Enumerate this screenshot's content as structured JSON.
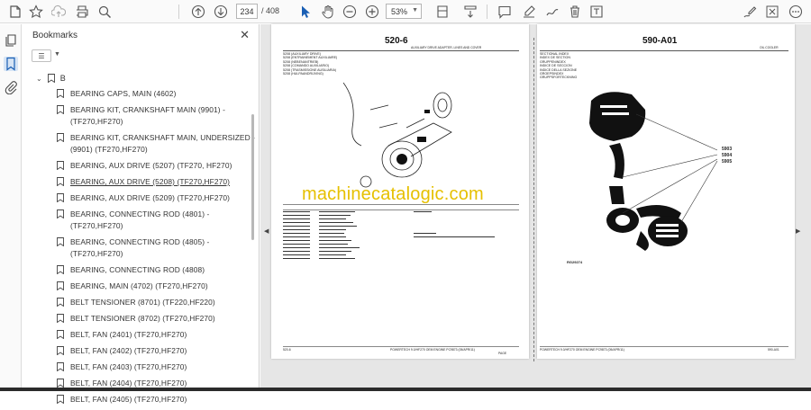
{
  "toolbar": {
    "page_current": "234",
    "page_total": "/ 408",
    "zoom": "53%"
  },
  "bookmarks": {
    "title": "Bookmarks",
    "root_label": "B",
    "items": [
      {
        "label": "BEARING CAPS, MAIN (4602)"
      },
      {
        "label": "BEARING KIT, CRANKSHAFT MAIN (9901) - (TF270,HF270)"
      },
      {
        "label": "BEARING KIT, CRANKSHAFT MAIN, UNDERSIZED - (9901) (TF270,HF270)"
      },
      {
        "label": "BEARING, AUX DRIVE (5207) (TF270, HF270)"
      },
      {
        "label": "BEARING, AUX DRIVE (5208) (TF270,HF270)"
      },
      {
        "label": "BEARING, AUX DRIVE (5209) (TF270,HF270)"
      },
      {
        "label": "BEARING, CONNECTING ROD (4801) - (TF270,HF270)"
      },
      {
        "label": "BEARING, CONNECTING ROD (4805) - (TF270,HF270)"
      },
      {
        "label": "BEARING, CONNECTING ROD (4808)"
      },
      {
        "label": "BEARING, MAIN (4702) (TF270,HF270)"
      },
      {
        "label": "BELT TENSIONER (8701) (TF220,HF220)"
      },
      {
        "label": "BELT TENSIONER (8702) (TF270,HF270)"
      },
      {
        "label": "BELT, FAN (2401) (TF270,HF270)"
      },
      {
        "label": "BELT, FAN (2402) (TF270,HF270)"
      },
      {
        "label": "BELT, FAN (2403) (TF270,HF270)"
      },
      {
        "label": "BELT, FAN (2404) (TF270,HF270)"
      },
      {
        "label": "BELT, FAN (2405) (TF270,HF270)"
      }
    ]
  },
  "left_page": {
    "heading": "520-6",
    "subtitle": "AUXILIARY DRIVE ADAPTER, LINES AND COVER",
    "group_lines": [
      "5208 (AUXILIARY DRIVE)",
      "5208 (ENTRAINEMENT AUXILIAIRE)",
      "5208 (NEBENANTRIEB)",
      "5208 (COMANDO AUXILIARIO)",
      "5208 (TRASMISSIONE AUSILIARIA)",
      "5208 (HULPAANDRIJVING)"
    ],
    "footer_left": "520-6",
    "footer_center": "POWERTECH 9.0/HF270 OEM ENGINE   PC9873   (05/APR/11)",
    "footer_right": "PAGE"
  },
  "right_page": {
    "heading": "590-A01",
    "subtitle": "OIL COOLER",
    "index_lines": [
      "SECTIONAL INDEX",
      "INDEX DE SECTION",
      "GRUPPENINDEX",
      "INDICE DE SECCION",
      "INDICE DELLA SEZIONE",
      "GROEPSINDEX",
      "GRUPPSFORTECKNING"
    ],
    "callouts": [
      "5903",
      "5904",
      "5905"
    ],
    "fig_label": "RG29274",
    "footer_center": "POWERTECH 9.0/HF270 OEM ENGINE   PC9873   (05/APR/11)",
    "footer_right": "590-A01"
  },
  "watermark": "machinecatalogic.com"
}
